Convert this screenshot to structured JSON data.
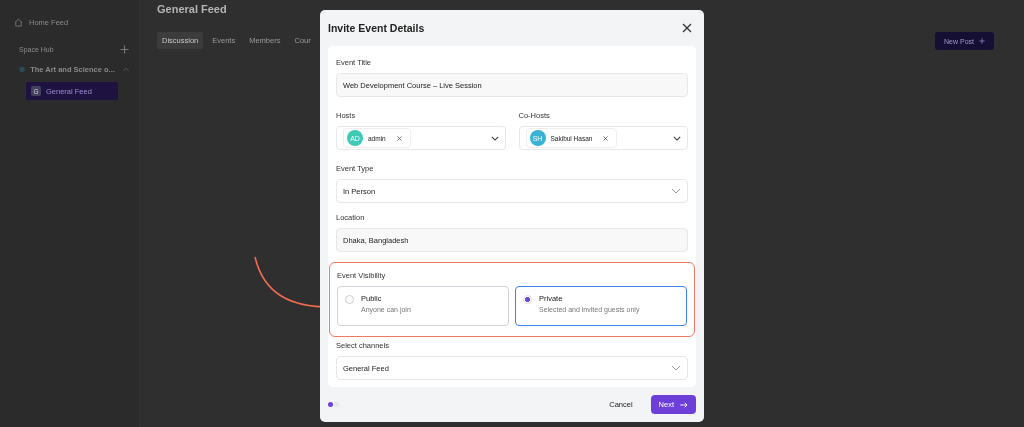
{
  "sidebar": {
    "home": "Home Feed",
    "section": "Space Hub",
    "space": {
      "name": "The Art and Science o...",
      "expanded": true
    },
    "channels": [
      {
        "icon": "G",
        "label": "General Feed",
        "selected": true
      }
    ]
  },
  "main": {
    "title": "General Feed",
    "new_post": "New Post",
    "tabs": [
      {
        "label": "Discussion",
        "selected": true
      },
      {
        "label": "Events",
        "selected": false
      },
      {
        "label": "Members",
        "selected": false
      },
      {
        "label": "Cour",
        "selected": false
      }
    ]
  },
  "modal": {
    "title": "Invite Event Details",
    "event_title": {
      "label": "Event Title",
      "value": "Web Development Course – Live Session"
    },
    "hosts": {
      "label": "Hosts",
      "chips": [
        {
          "initials": "AD",
          "name": "admin",
          "color": "#3fcab6"
        }
      ]
    },
    "co_hosts": {
      "label": "Co-Hosts",
      "chips": [
        {
          "initials": "SH",
          "name": "Sakibul Hasan",
          "color": "#3ab2d2"
        }
      ]
    },
    "event_type": {
      "label": "Event Type",
      "value": "In Person"
    },
    "location": {
      "label": "Location",
      "value": "Dhaka, Bangladesh"
    },
    "visibility": {
      "label": "Event Visibility",
      "options": [
        {
          "title": "Public",
          "description": "Anyone can join",
          "selected": false
        },
        {
          "title": "Private",
          "description": "Selected and invited guests only",
          "selected": true
        }
      ]
    },
    "channels": {
      "label": "Select channels",
      "value": "General Feed"
    },
    "steps": [
      {
        "selected": true
      },
      {
        "selected": false
      }
    ],
    "cancel": "Cancel",
    "next": "Next"
  }
}
